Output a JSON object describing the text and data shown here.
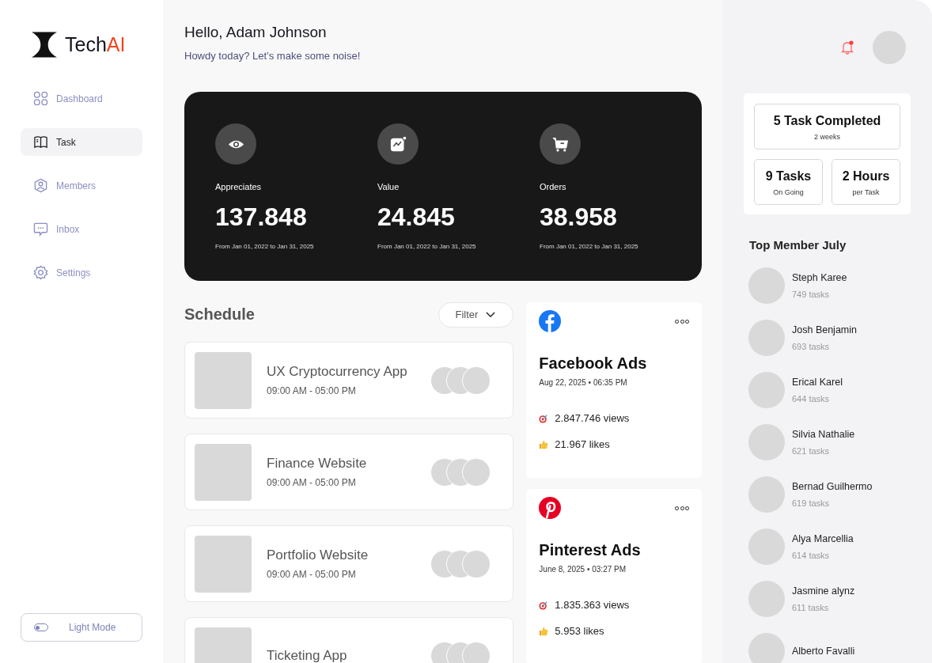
{
  "brand": {
    "name": "Tech",
    "accent": "AI"
  },
  "sidebar": {
    "items": [
      {
        "label": "Dashboard",
        "kind": "grid",
        "selected": false
      },
      {
        "label": "Task",
        "kind": "book",
        "selected": true
      },
      {
        "label": "Members",
        "kind": "user",
        "selected": false
      },
      {
        "label": "Inbox",
        "kind": "chat",
        "selected": false
      },
      {
        "label": "Settings",
        "kind": "gear",
        "selected": false
      }
    ],
    "mode_toggle": {
      "label": "Light Mode",
      "on": false
    }
  },
  "header": {
    "greeting": "Hello, Adam Johnson",
    "subtitle": "Howdy today? Let’s make some noise!",
    "notification": true
  },
  "stats": [
    {
      "kind": "eye",
      "label": "Appreciates",
      "value": "137.848",
      "range": "From Jan 01, 2022 to Jan 31, 2025"
    },
    {
      "kind": "chart",
      "label": "Value",
      "value": "24.845",
      "range": "From Jan 01, 2022 to Jan 31, 2025"
    },
    {
      "kind": "cart",
      "label": "Orders",
      "value": "38.958",
      "range": "From Jan 01, 2022 to Jan 31, 2025"
    }
  ],
  "schedule": {
    "title": "Schedule",
    "filter": "Filter",
    "items": [
      {
        "title": "UX Cryptocurrency App",
        "time": "09:00 AM - 05:00 PM"
      },
      {
        "title": "Finance Website",
        "time": "09:00 AM - 05:00 PM"
      },
      {
        "title": "Portfolio Website",
        "time": "09:00 AM - 05:00 PM"
      },
      {
        "title": "Ticketing App"
      }
    ]
  },
  "ads": [
    {
      "kind": "facebook",
      "title": "Facebook Ads",
      "date": "Aug 22, 2025 • 06:35 PM",
      "views": "2.847.746 views",
      "likes": "21.967 likes"
    },
    {
      "kind": "pinterest",
      "title": "Pinterest Ads",
      "date": "June 8, 2025 • 03:27 PM",
      "views": "1.835.363 views",
      "likes": "5.953 likes"
    }
  ],
  "summary": {
    "main": {
      "value": "5 Task Completed",
      "caption": "2 weeks"
    },
    "small": [
      {
        "value": "9 Tasks",
        "caption": "On Going"
      },
      {
        "value": "2 Hours",
        "caption": "per Task"
      }
    ]
  },
  "top_members": {
    "title": "Top Member July",
    "items": [
      {
        "name": "Steph Karee",
        "tasks": "749 tasks"
      },
      {
        "name": "Josh Benjamin",
        "tasks": "693 tasks"
      },
      {
        "name": "Erical Karel",
        "tasks": "644 tasks"
      },
      {
        "name": "Silvia Nathalie",
        "tasks": "621  tasks"
      },
      {
        "name": "Bernad Guilhermo",
        "tasks": "619 tasks"
      },
      {
        "name": "Alya Marcellia",
        "tasks": "614 tasks"
      },
      {
        "name": "Jasmine alynz",
        "tasks": "611 tasks"
      },
      {
        "name": "Alberto Favalli"
      }
    ]
  }
}
